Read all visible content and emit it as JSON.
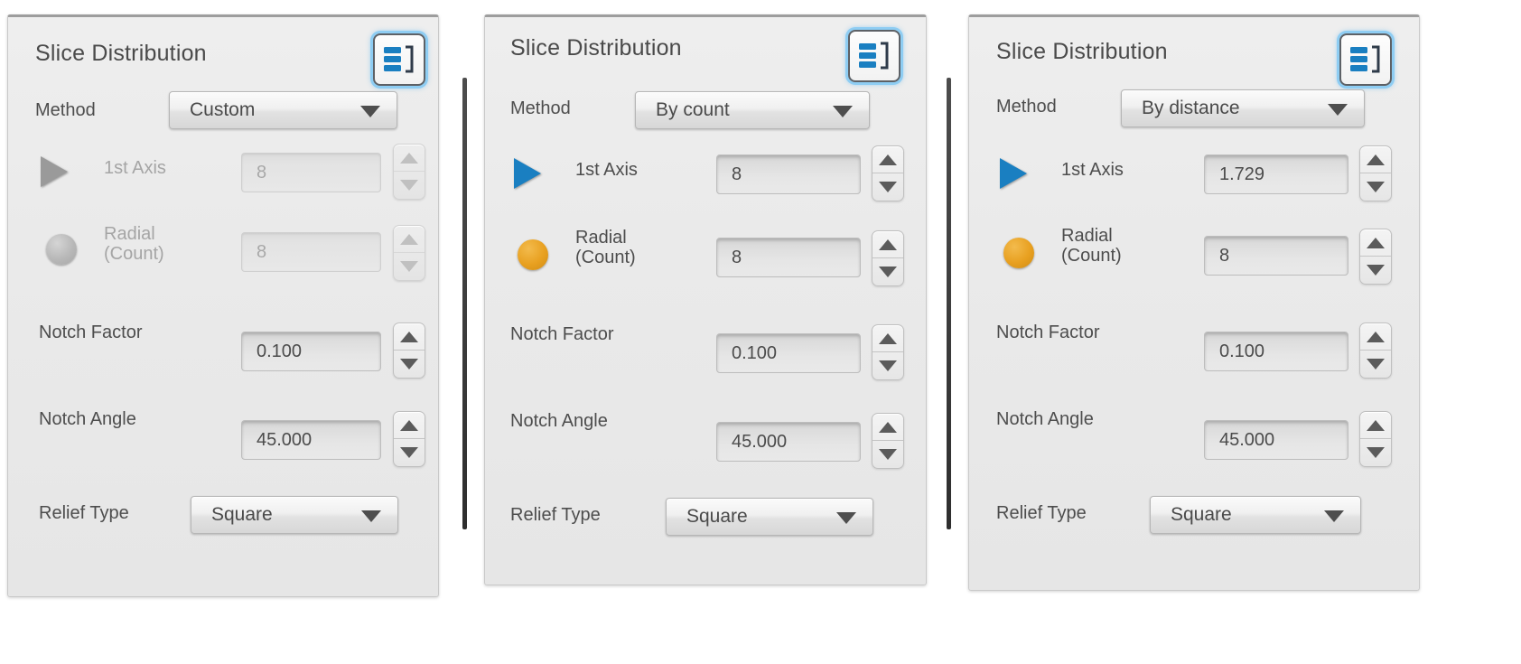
{
  "icons": {
    "list_icon": "list-bracket-icon",
    "caret": "chevron-down-icon",
    "spin_up": "triangle-up-icon",
    "spin_down": "triangle-down-icon",
    "axis_toggle": "triangle-right-icon",
    "radial_toggle": "circle-icon"
  },
  "colors": {
    "accent_blue": "#1a7fc1",
    "accent_orange": "#e8a020",
    "focus_glow": "#8ecdf3",
    "panel_bg": "#eaeaea",
    "text": "#4a4a4a",
    "text_disabled": "#a5a5a5"
  },
  "panels": [
    {
      "title": "Slice Distribution",
      "icon_button_name": "list-view-button",
      "method": {
        "label": "Method",
        "value": "Custom"
      },
      "axis": {
        "label": "1st Axis",
        "value": "8",
        "enabled": false,
        "indicator": "triangle-right-icon"
      },
      "radial": {
        "label_line1": "Radial",
        "label_line2": "(Count)",
        "value": "8",
        "enabled": false,
        "indicator": "circle-icon"
      },
      "notch_factor": {
        "label": "Notch Factor",
        "value": "0.100",
        "enabled": true
      },
      "notch_angle": {
        "label": "Notch Angle",
        "value": "45.000",
        "enabled": true
      },
      "relief": {
        "label": "Relief Type",
        "value": "Square"
      }
    },
    {
      "title": "Slice Distribution",
      "icon_button_name": "list-view-button",
      "method": {
        "label": "Method",
        "value": "By count"
      },
      "axis": {
        "label": "1st Axis",
        "value": "8",
        "enabled": true,
        "indicator": "triangle-right-icon"
      },
      "radial": {
        "label_line1": "Radial",
        "label_line2": "(Count)",
        "value": "8",
        "enabled": true,
        "indicator": "circle-icon"
      },
      "notch_factor": {
        "label": "Notch Factor",
        "value": "0.100",
        "enabled": true
      },
      "notch_angle": {
        "label": "Notch Angle",
        "value": "45.000",
        "enabled": true
      },
      "relief": {
        "label": "Relief Type",
        "value": "Square"
      }
    },
    {
      "title": "Slice Distribution",
      "icon_button_name": "list-view-button",
      "method": {
        "label": "Method",
        "value": "By distance"
      },
      "axis": {
        "label": "1st Axis",
        "value": "1.729",
        "enabled": true,
        "indicator": "triangle-right-icon"
      },
      "radial": {
        "label_line1": "Radial",
        "label_line2": "(Count)",
        "value": "8",
        "enabled": true,
        "indicator": "circle-icon"
      },
      "notch_factor": {
        "label": "Notch Factor",
        "value": "0.100",
        "enabled": true
      },
      "notch_angle": {
        "label": "Notch Angle",
        "value": "45.000",
        "enabled": true
      },
      "relief": {
        "label": "Relief Type",
        "value": "Square"
      }
    }
  ]
}
